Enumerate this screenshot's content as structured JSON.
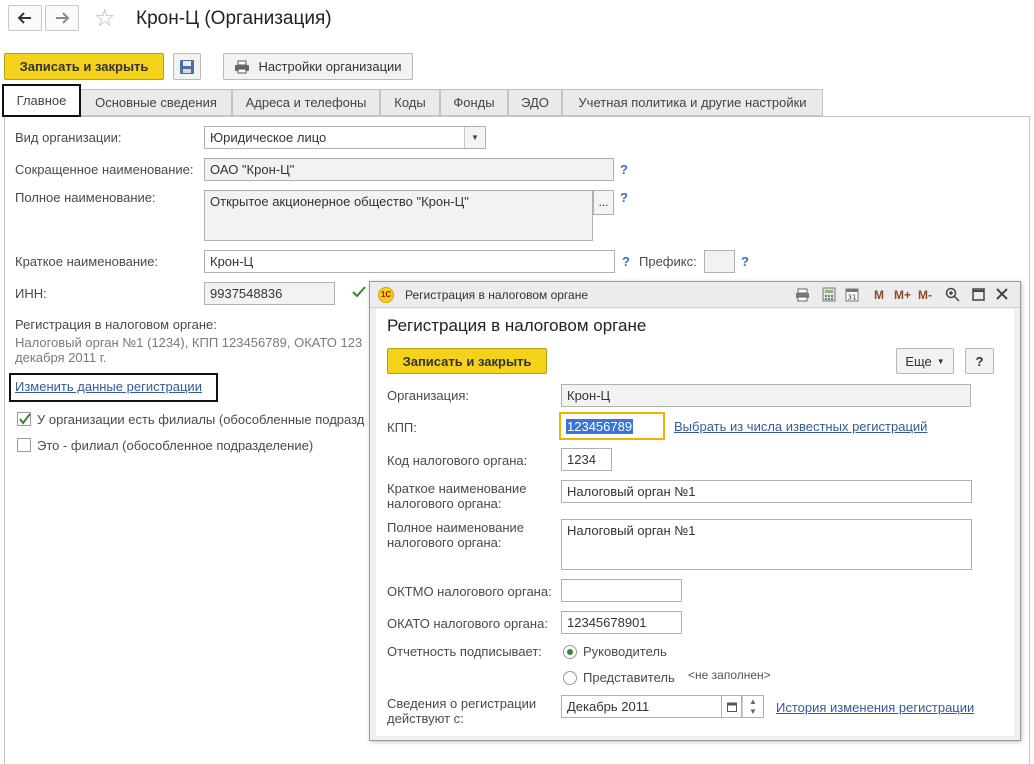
{
  "window": {
    "title": "Крон-Ц (Организация)"
  },
  "toolbar": {
    "save_close_label": "Записать и закрыть",
    "settings_label": "Настройки организации"
  },
  "tabs": [
    {
      "label": "Главное"
    },
    {
      "label": "Основные сведения"
    },
    {
      "label": "Адреса и телефоны"
    },
    {
      "label": "Коды"
    },
    {
      "label": "Фонды"
    },
    {
      "label": "ЭДО"
    },
    {
      "label": "Учетная политика и другие настройки"
    }
  ],
  "form": {
    "org_type_label": "Вид организации:",
    "org_type_value": "Юридическое лицо",
    "short_name_label": "Сокращенное наименование:",
    "short_name_value": "ОАО \"Крон-Ц\"",
    "full_name_label": "Полное наименование:",
    "full_name_value": "Открытое акционерное общество \"Крон-Ц\"",
    "brief_name_label": "Краткое наименование:",
    "brief_name_value": "Крон-Ц",
    "prefix_label": "Префикс:",
    "prefix_value": "",
    "inn_label": "ИНН:",
    "inn_value": "9937548836",
    "tax_reg_label": "Регистрация в налоговом органе:",
    "tax_reg_line1": "Налоговый орган №1 (1234), КПП 123456789, ОКАТО 123",
    "tax_reg_line2": "декабря 2011 г.",
    "change_reg_link": "Изменить данные регистрации",
    "branches_label": "У организации есть филиалы (обособленные подразд",
    "is_branch_label": "Это - филиал (обособленное подразделение)",
    "help_mark": "?"
  },
  "dialog": {
    "window_title": "Регистрация в налоговом органе",
    "heading": "Регистрация в налоговом органе",
    "save_close_label": "Записать и закрыть",
    "more_label": "Еще",
    "help_label": "?",
    "toolbar_icons": [
      "print-icon",
      "calculator-icon",
      "calendar-icon",
      "M",
      "M+",
      "M-",
      "zoom-icon",
      "maximize-icon",
      "close-icon"
    ],
    "organization_label": "Организация:",
    "organization_value": "Крон-Ц",
    "kpp_label": "КПП:",
    "kpp_value": "123456789",
    "choose_known_link": "Выбрать из числа известных регистраций",
    "tax_code_label": "Код налогового органа:",
    "tax_code_value": "1234",
    "brief_name_label_1": "Краткое наименование",
    "brief_name_label_2": "налогового органа:",
    "brief_name_value": "Налоговый орган №1",
    "full_name_label_1": "Полное наименование",
    "full_name_label_2": "налогового органа:",
    "full_name_value": "Налоговый орган №1",
    "oktmo_label": "ОКТМО налогового органа:",
    "oktmo_value": "",
    "okato_label": "ОКАТО налогового органа:",
    "okato_value": "12345678901",
    "signer_label": "Отчетность подписывает:",
    "signer_head": "Руководитель",
    "signer_rep": "Представитель",
    "not_filled": "<не заполнен>",
    "valid_from_label_1": "Сведения о регистрации",
    "valid_from_label_2": "действуют с:",
    "valid_from_value": "Декабрь 2011",
    "history_link": "История изменения регистрации"
  },
  "colors": {
    "accent_yellow": "#f5d21a",
    "link_blue": "#335b98",
    "check_green": "#2e8b2e",
    "focus_orange": "#f0b400",
    "selection_blue": "#3875d7"
  }
}
